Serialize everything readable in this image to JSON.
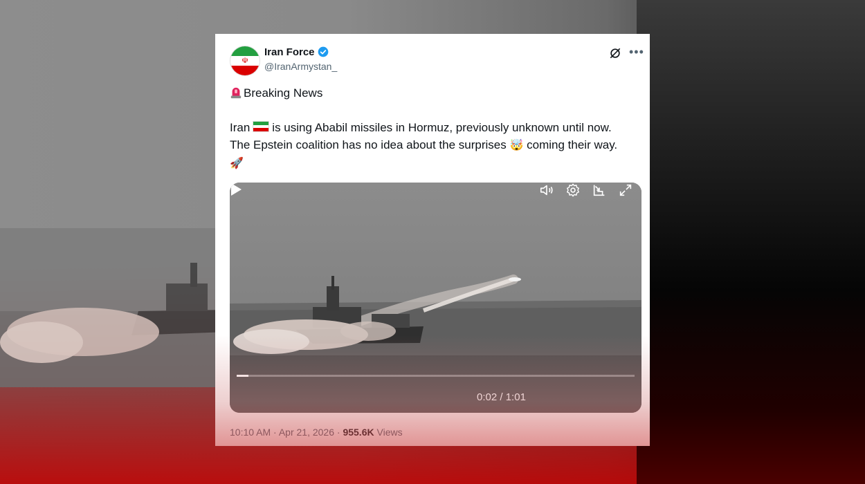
{
  "post": {
    "author_name": "Iran Force",
    "author_handle": "@IranArmystan_",
    "headline": "Breaking News",
    "body_part1": "Iran",
    "body_part2": "is using Ababil missiles in Hormuz, previously unknown until now. The Epstein coalition has no idea about the surprises",
    "body_part3": "coming their way.",
    "emoji_surprise": "🤯",
    "emoji_rocket": "🚀",
    "timestamp": "10:10 AM · Apr 21, 2026",
    "separator": " · ",
    "views_count": "955.6K",
    "views_label": "Views"
  },
  "video": {
    "current_time": "0:02",
    "duration": "1:01",
    "time_separator": " / ",
    "progress_fraction": 0.03
  },
  "icons": {
    "verified": "verified-badge-icon",
    "grok": "grok-icon",
    "more": "more-icon",
    "play": "play-icon",
    "volume": "volume-icon",
    "settings": "settings-gear-icon",
    "pip": "picture-in-picture-icon",
    "fullscreen": "fullscreen-icon"
  },
  "colors": {
    "accent": "#1d9bf0",
    "text": "#0f1419",
    "muted": "#536471",
    "background_red": "#c00000"
  }
}
